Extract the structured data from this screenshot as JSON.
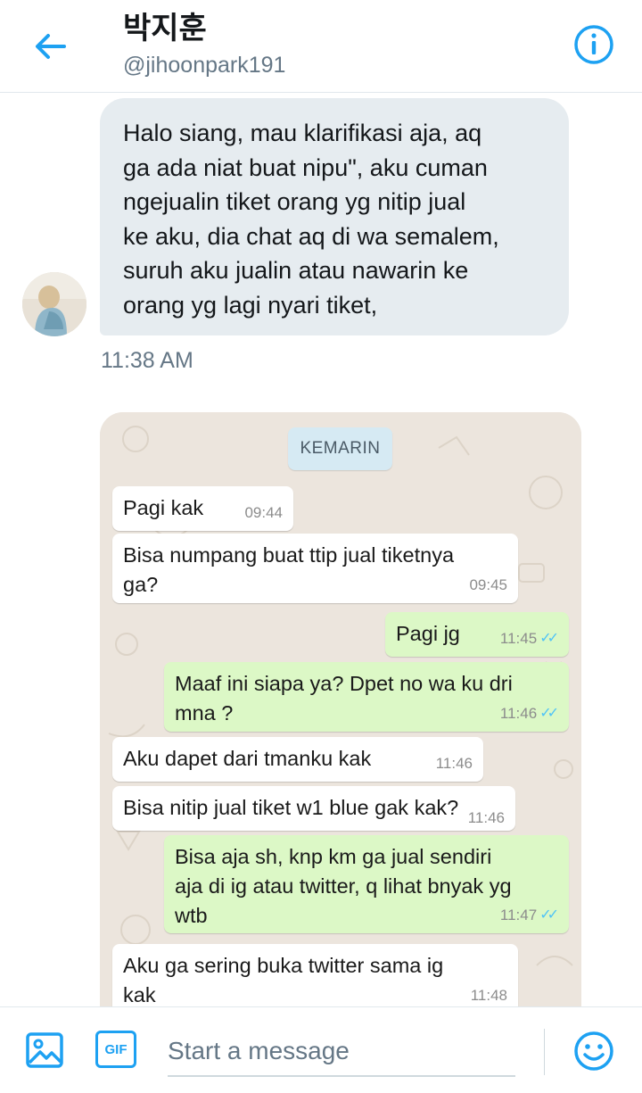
{
  "header": {
    "title": "박지훈",
    "handle": "@jihoonpark191"
  },
  "colors": {
    "accent": "#1da1f2",
    "dm_bubble": "#e6ecf0",
    "wa_outgoing": "#dcf8c6",
    "wa_incoming": "#ffffff",
    "wa_background": "#ece5dd"
  },
  "icons": {
    "back": "arrow-left-icon",
    "info": "info-icon",
    "photo": "image-icon",
    "gif": "gif-icon",
    "emoji": "smiley-icon"
  },
  "dm": {
    "text": "Halo siang, mau klarifikasi aja, aq\nga ada niat buat nipu\", aku cuman\nngejualin tiket orang yg nitip jual\nke aku, dia chat aq di wa semalem,\nsuruh aku jualin atau nawarin ke\norang yg lagi nyari tiket,",
    "time": "11:38 AM"
  },
  "whatsapp": {
    "date_chip": "KEMARIN",
    "messages": [
      {
        "dir": "in",
        "text": "Pagi kak",
        "time": "09:44"
      },
      {
        "dir": "in",
        "text": "Bisa numpang buat ttip jual tiketnya\nga?",
        "time": "09:45"
      },
      {
        "dir": "out",
        "text": "Pagi jg",
        "time": "11:45"
      },
      {
        "dir": "out",
        "text": "Maaf ini siapa ya? Dpet no wa ku dri\nmna ?",
        "time": "11:46"
      },
      {
        "dir": "in",
        "text": "Aku dapet dari tmanku kak",
        "time": "11:46"
      },
      {
        "dir": "in",
        "text": "Bisa nitip jual tiket w1 blue gak kak?",
        "time": "11:46"
      },
      {
        "dir": "out",
        "text": "Bisa aja sh, knp km ga jual sendiri\naja di ig atau twitter, q lihat bnyak yg\nwtb",
        "time": "11:47"
      },
      {
        "dir": "in",
        "text": "Aku ga sering buka twitter sama ig\nkak",
        "time": "11:48"
      }
    ]
  },
  "composer": {
    "gif_label": "GIF",
    "placeholder": "Start a message"
  }
}
